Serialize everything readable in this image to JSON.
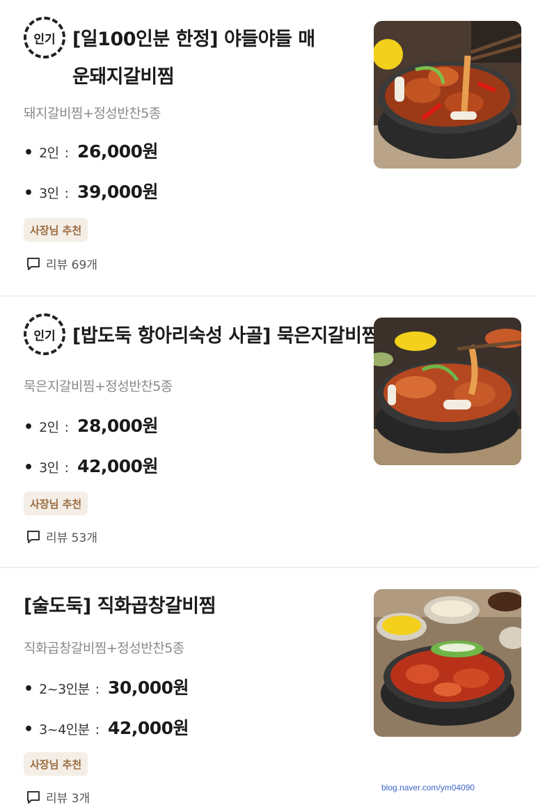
{
  "items": [
    {
      "popular_badge": "인기",
      "title": "[일100인분 한정] 야들야들 매운돼지갈비찜",
      "description": "돼지갈비찜+정성반찬5종",
      "prices": [
        {
          "size": "2인",
          "price": "26,000원"
        },
        {
          "size": "3인",
          "price": "39,000원"
        }
      ],
      "tag": "사장님 추천",
      "review": "리뷰 69개",
      "photo_icon": "braised-pork-rib-photo"
    },
    {
      "popular_badge": "인기",
      "title": "[밥도둑 항아리숙성 사골] 묵은지갈비찜",
      "description": "묵은지갈비찜+정성반찬5종",
      "prices": [
        {
          "size": "2인",
          "price": "28,000원"
        },
        {
          "size": "3인",
          "price": "42,000원"
        }
      ],
      "tag": "사장님 추천",
      "review": "리뷰 53개",
      "photo_icon": "kimchi-rib-photo"
    },
    {
      "title": "[술도둑] 직화곱창갈비찜",
      "description": "직화곱창갈비찜+정성반찬5종",
      "prices": [
        {
          "size": "2~3인분",
          "price": "30,000원"
        },
        {
          "size": "3~4인분",
          "price": "42,000원"
        }
      ],
      "tag": "사장님 추천",
      "review": "리뷰 3개",
      "photo_icon": "grilled-tripe-rib-photo"
    }
  ],
  "watermark": "blog.naver.com/ym04090",
  "colors": {
    "tag_bg": "#f4eee7",
    "tag_text": "#9a6a3e",
    "desc_text": "#8a8a8a",
    "divider": "#efefef",
    "watermark": "#3c66c9"
  }
}
